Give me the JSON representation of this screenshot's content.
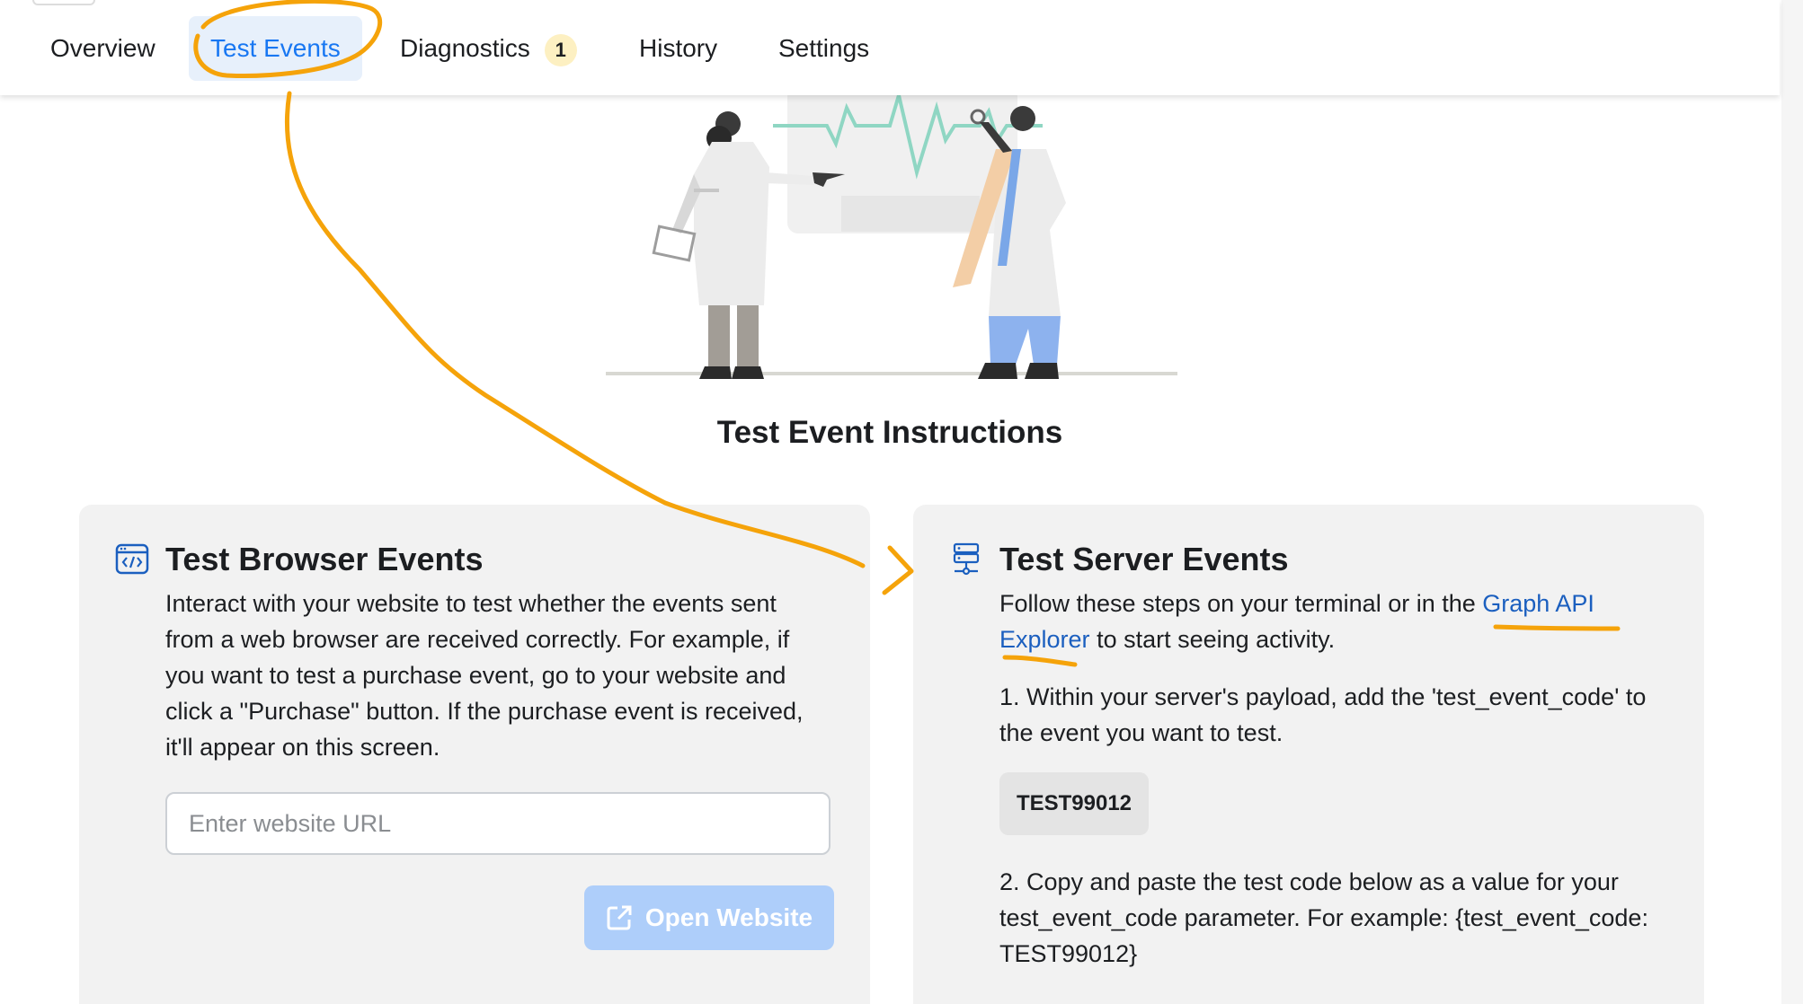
{
  "tabs": {
    "overview": "Overview",
    "test_events": "Test Events",
    "diagnostics": "Diagnostics",
    "diagnostics_badge": "1",
    "history": "History",
    "settings": "Settings",
    "active": "test_events"
  },
  "section_title": "Test Event Instructions",
  "browser_card": {
    "icon": "code-window-icon",
    "title": "Test Browser Events",
    "lines": [
      "Interact with your website to test whether the events sent",
      "from a web browser are received correctly. For example, if",
      "you want to test a purchase event, go to your website and",
      "click a \"Purchase\" button. If the purchase event is received,",
      "it'll appear on this screen."
    ],
    "url_placeholder": "Enter website URL",
    "url_value": "",
    "open_button": "Open Website",
    "open_button_icon": "external-link-icon"
  },
  "server_card": {
    "icon": "server-icon",
    "title": "Test Server Events",
    "intro_prefix": "Follow these steps on your terminal or in the",
    "intro_link_line1": "Graph API",
    "intro_link_line2": "Explorer",
    "intro_suffix": "to start seeing activity.",
    "step1_line1": "1. Within your server's payload, add the 'test_event_code' to",
    "step1_line2": "the event you want to test.",
    "test_code": "TEST99012",
    "step2_line1": "2. Copy and paste the test code below as a value for your",
    "step2_line2": "test_event_code parameter. For example: {test_event_code:",
    "step2_line3": "TEST99012}"
  },
  "colors": {
    "accent": "#1877f2",
    "link": "#1b5fbf",
    "annotation": "#f5a30a",
    "card_bg": "#f2f2f2",
    "badge_bg": "#fdf0c2",
    "disabled_button": "#aecefa"
  }
}
